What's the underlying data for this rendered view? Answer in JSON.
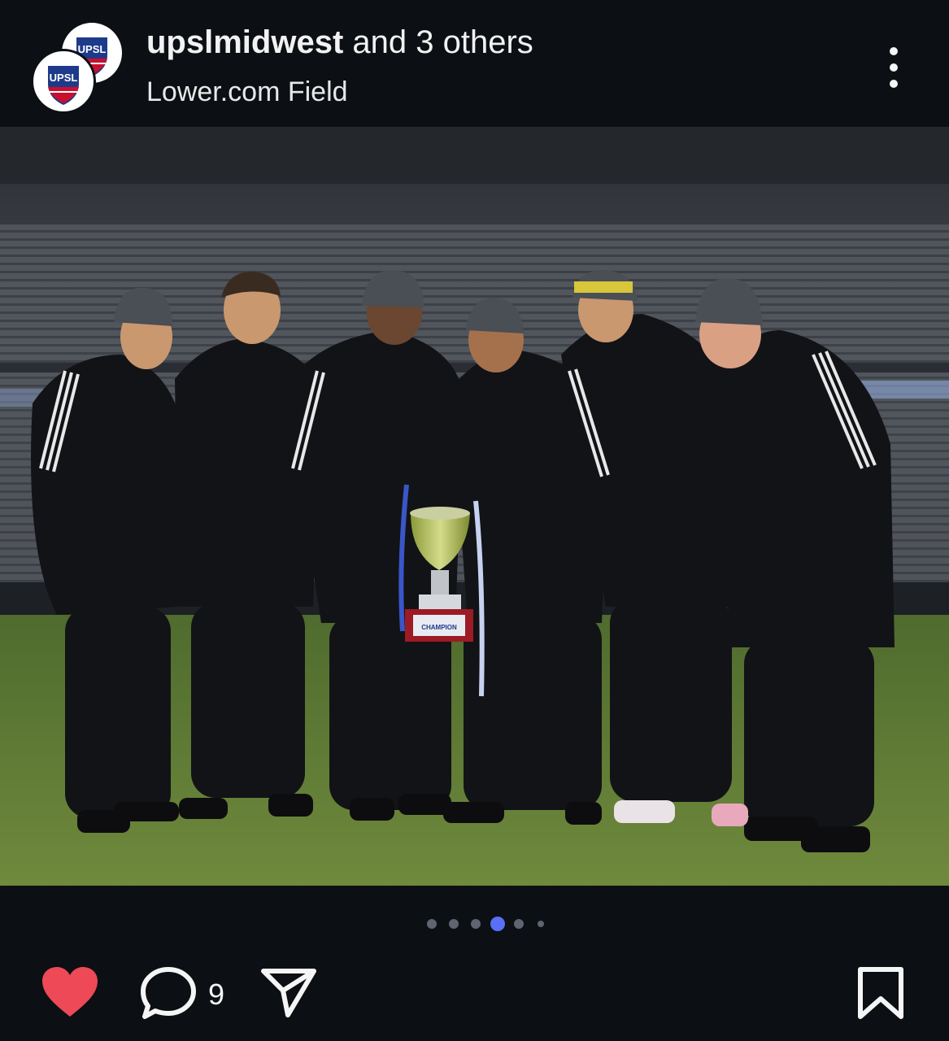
{
  "post": {
    "account": "upslmidwest",
    "coauthor_text": " and 3 others",
    "location": "Lower.com Field",
    "avatar_text": "UPSL"
  },
  "carousel": {
    "total": 6,
    "active_index": 3
  },
  "actions": {
    "liked": true,
    "comment_count": "9",
    "like_color": "#ed4956"
  },
  "photo": {
    "trophy_label": "CHAMPION",
    "description_icons": [
      "heart-icon",
      "comment-icon",
      "share-icon",
      "bookmark-icon",
      "more-icon"
    ]
  }
}
